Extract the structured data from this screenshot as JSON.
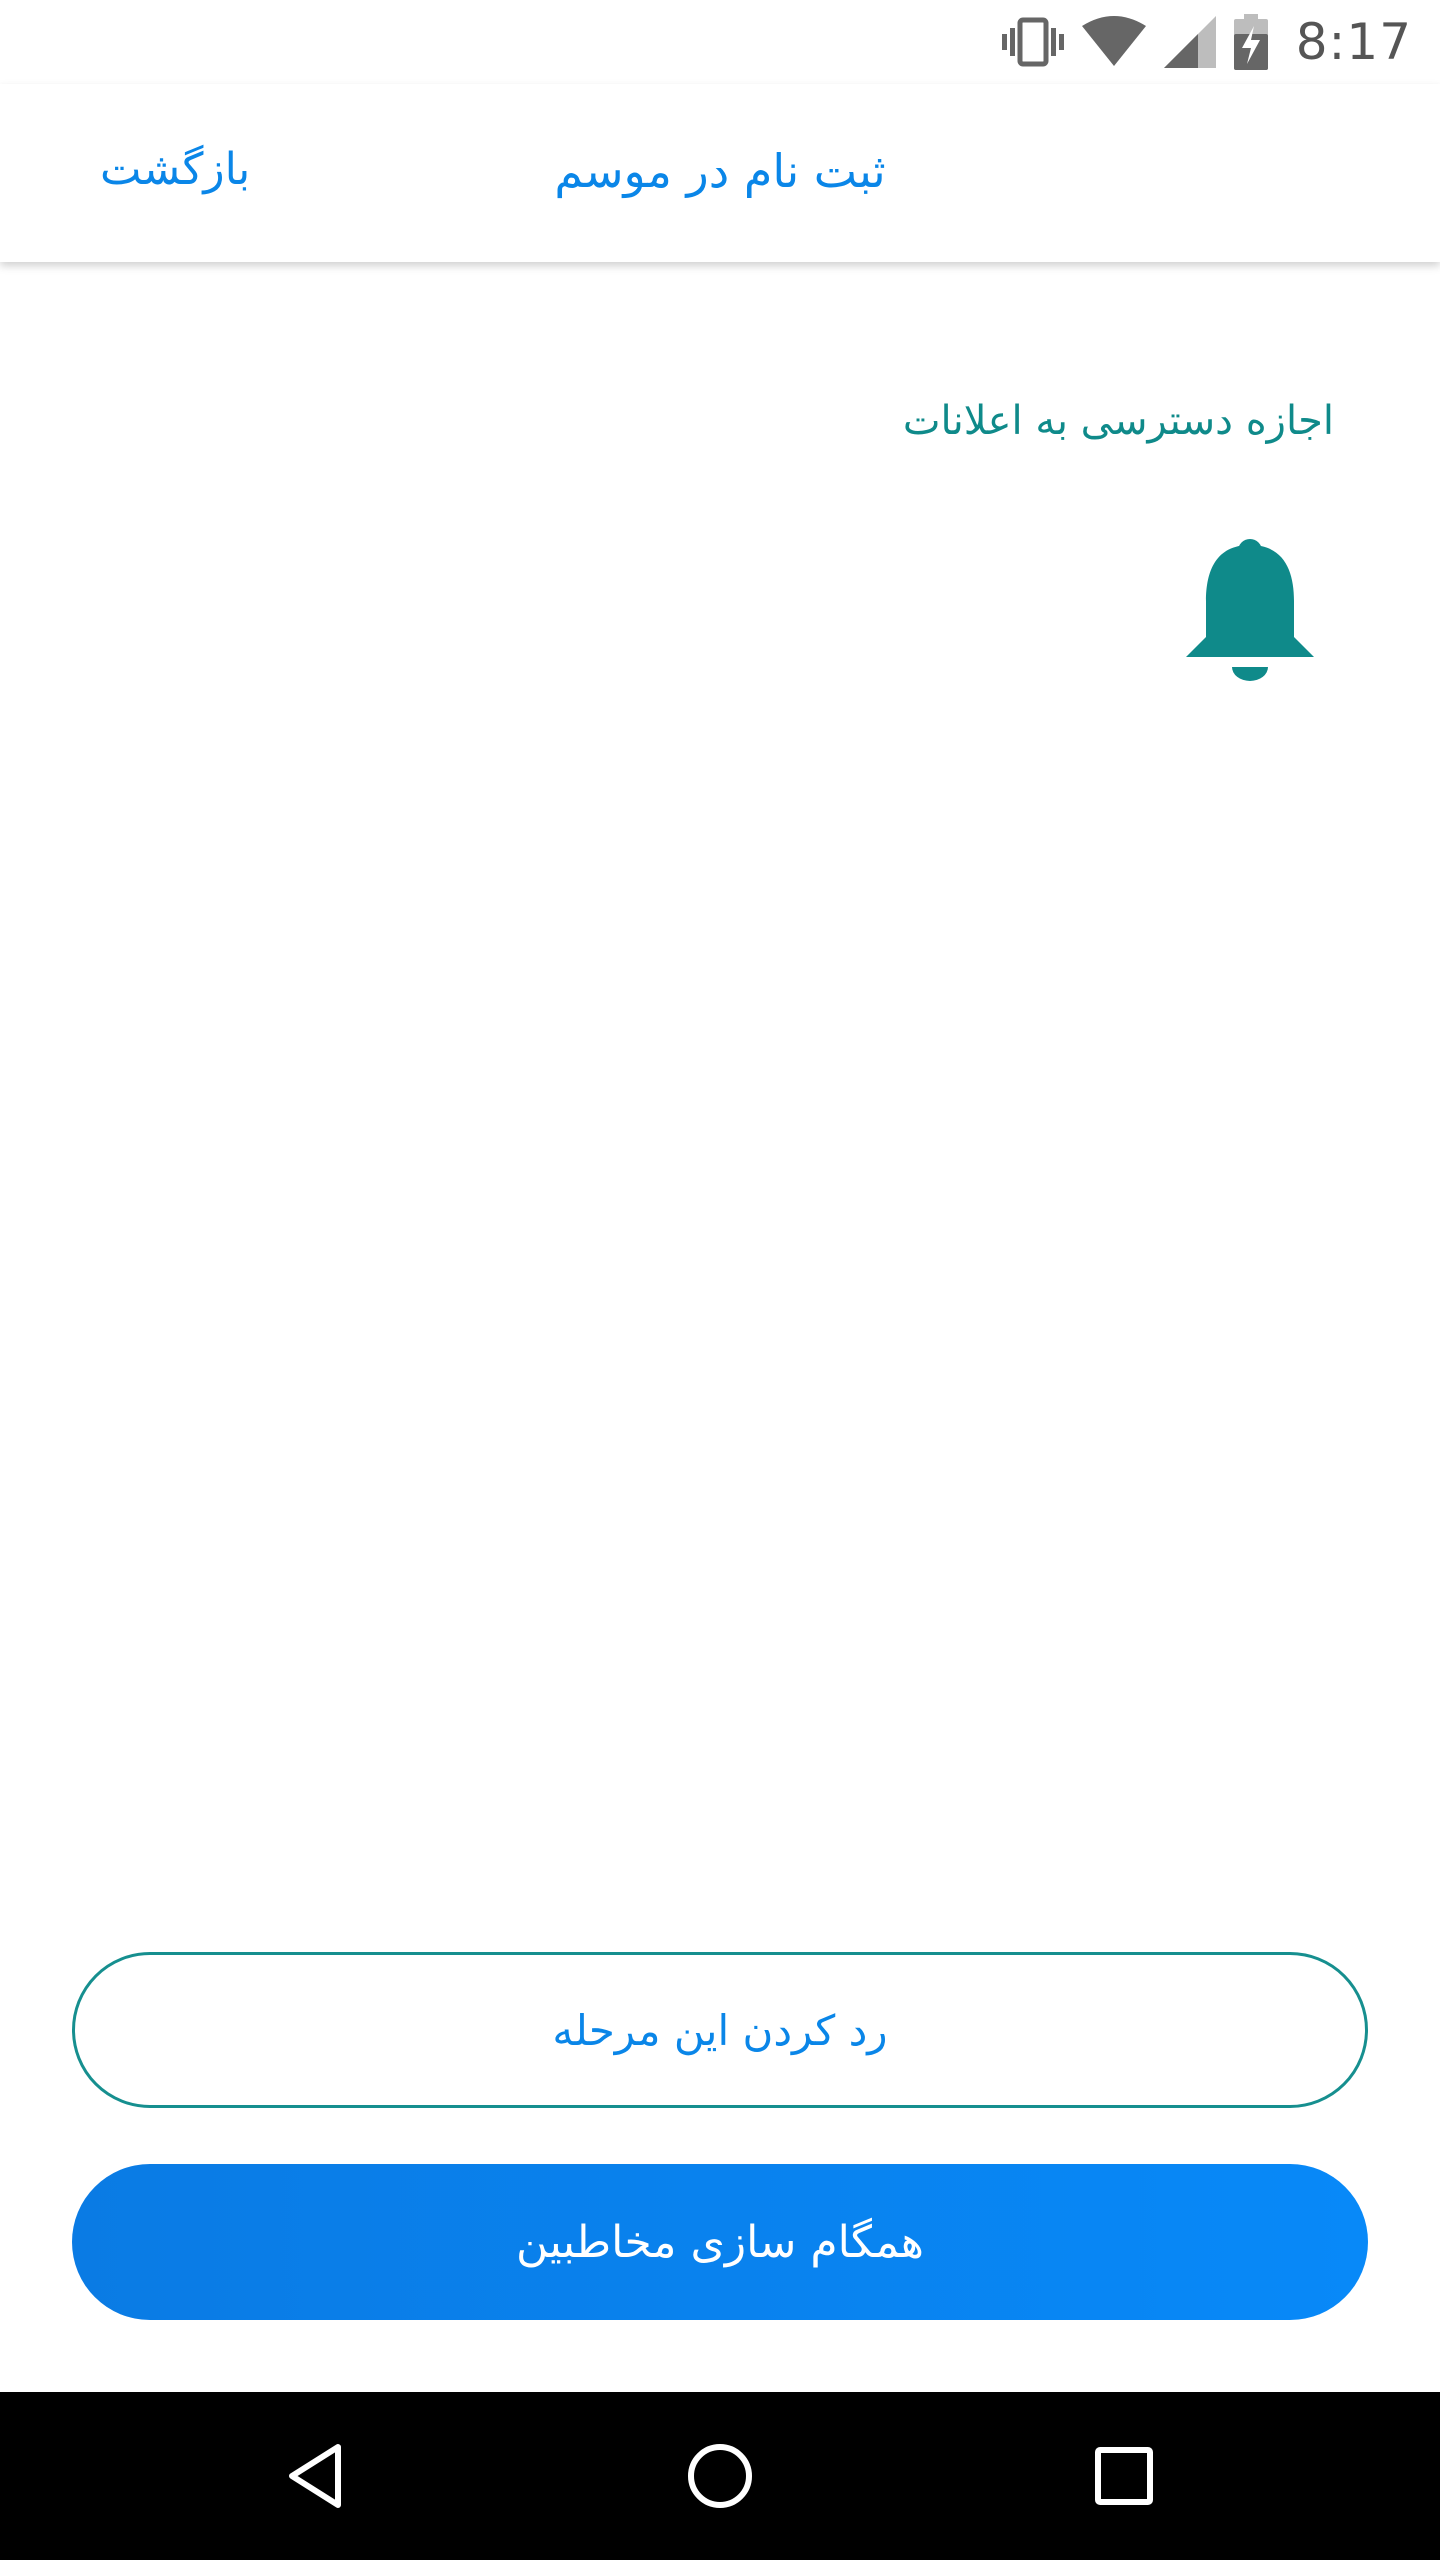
{
  "status_bar": {
    "time": "8:17",
    "icons": [
      "vibrate-icon",
      "wifi-icon",
      "signal-icon",
      "battery-charging-icon"
    ]
  },
  "app_bar": {
    "title": "ثبت نام در موسم",
    "back_label": "بازگشت"
  },
  "content": {
    "permission_label": "اجازه دسترسی به اعلانات",
    "icon": "bell-icon"
  },
  "buttons": {
    "skip_label": "رد کردن این مرحله",
    "sync_label": "همگام سازی مخاطبین"
  },
  "nav_bar": {
    "icons": [
      "nav-back-icon",
      "nav-home-icon",
      "nav-recents-icon"
    ]
  },
  "colors": {
    "accent_blue": "#0a86e8",
    "teal": "#0f8a8a",
    "button_blue": "#0889f8",
    "nav_background": "#000000"
  }
}
